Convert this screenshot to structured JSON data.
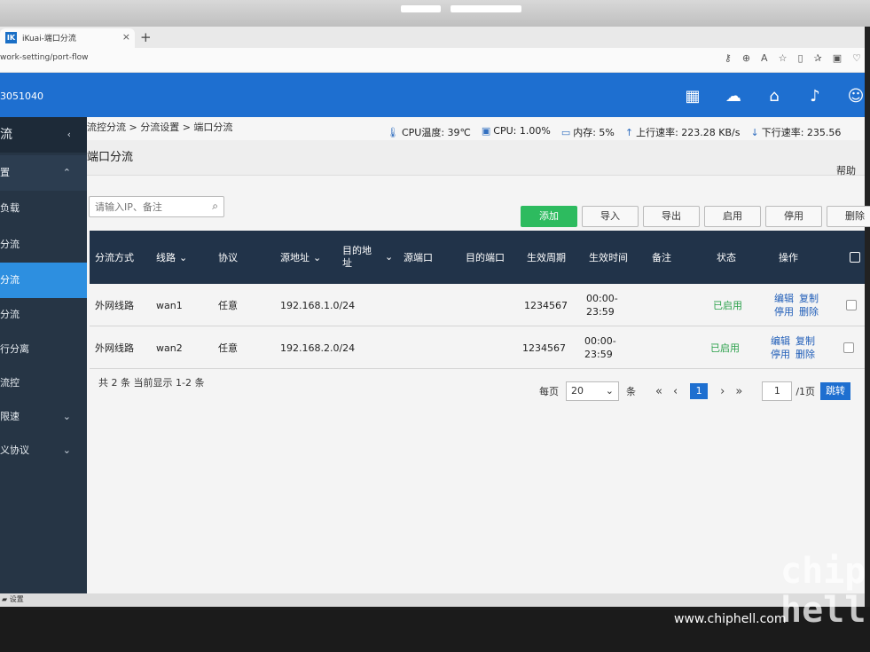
{
  "browser": {
    "tab_title": "iKuai-端口分流",
    "favicon_text": "IK",
    "tab_close": "×",
    "new_tab": "+",
    "url": "work-setting/port-flow"
  },
  "header": {
    "device_id": "3051040"
  },
  "sidebar": {
    "items": [
      {
        "label": "流",
        "arrow": "‹"
      },
      {
        "label": "置",
        "arrow": "⌃"
      },
      {
        "label": "负载",
        "arrow": ""
      },
      {
        "label": "分流",
        "arrow": ""
      },
      {
        "label": "分流",
        "arrow": ""
      },
      {
        "label": "分流",
        "arrow": ""
      },
      {
        "label": "行分离",
        "arrow": ""
      },
      {
        "label": "流控",
        "arrow": ""
      },
      {
        "label": "限速",
        "arrow": "⌄"
      },
      {
        "label": "义协议",
        "arrow": "⌄"
      }
    ]
  },
  "breadcrumb": "流控分流 > 分流设置 > 端口分流",
  "stats": {
    "cpu_temp": "CPU温度: 39℃",
    "cpu": "CPU: 1.00%",
    "mem": "内存: 5%",
    "up": "上行速率: 223.28 KB/s",
    "down": "下行速率: 235.56"
  },
  "page": {
    "title": "端口分流",
    "help": "帮助"
  },
  "search": {
    "placeholder": "请输入IP、备注"
  },
  "buttons": {
    "add": "添加",
    "import": "导入",
    "export": "导出",
    "enable": "启用",
    "disable": "停用",
    "delete": "删除"
  },
  "table": {
    "headers": {
      "mode": "分流方式",
      "line": "线路",
      "protocol": "协议",
      "src": "源地址",
      "dst_a": "目的地",
      "dst_b": "址",
      "sport": "源端口",
      "dport": "目的端口",
      "cycle": "生效周期",
      "time": "生效时间",
      "note": "备注",
      "status": "状态",
      "ops": "操作"
    },
    "rows": [
      {
        "mode": "外网线路",
        "line": "wan1",
        "protocol": "任意",
        "src": "192.168.1.0/24",
        "cycle": "1234567",
        "time_a": "00:00-",
        "time_b": "23:59",
        "status": "已启用",
        "edit": "编辑",
        "copy": "复制",
        "stop": "停用",
        "del": "删除"
      },
      {
        "mode": "外网线路",
        "line": "wan2",
        "protocol": "任意",
        "src": "192.168.2.0/24",
        "cycle": "1234567",
        "time_a": "00:00-",
        "time_b": "23:59",
        "status": "已启用",
        "edit": "编辑",
        "copy": "复制",
        "stop": "停用",
        "del": "删除"
      }
    ]
  },
  "pagination": {
    "summary": "共 2 条 当前显示 1-2 条",
    "per_page_label": "每页",
    "per_page_value": "20",
    "unit": "条",
    "current": "1",
    "jump_value": "1",
    "total_pages": "/1页",
    "jump": "跳转"
  },
  "taskbar": {
    "label": "设置"
  },
  "watermark": {
    "site": "www.chiphell.com",
    "logo": "chip hell"
  }
}
